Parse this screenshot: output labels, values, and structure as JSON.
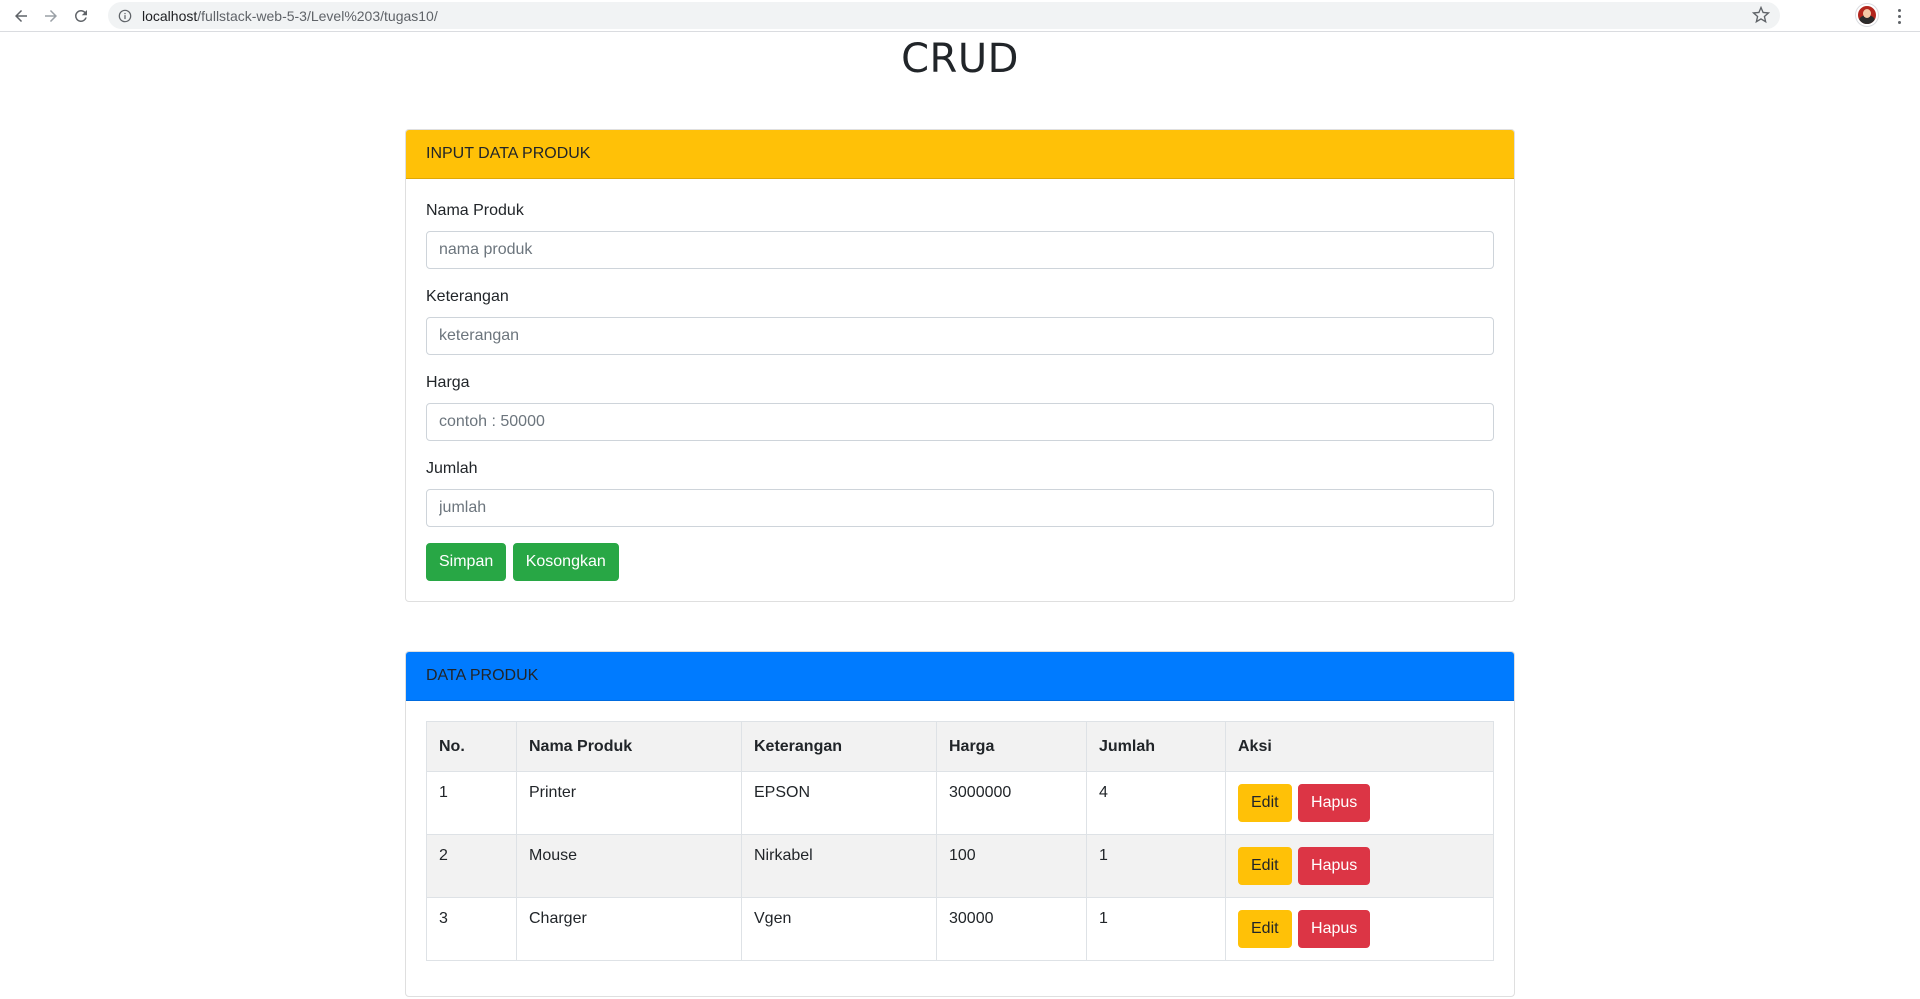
{
  "browser": {
    "url_host": "localhost",
    "url_path": "/fullstack-web-5-3/Level%203/tugas10/"
  },
  "page": {
    "title": "CRUD"
  },
  "input_card": {
    "header": "INPUT DATA PRODUK",
    "fields": [
      {
        "label": "Nama Produk",
        "placeholder": "nama produk",
        "value": ""
      },
      {
        "label": "Keterangan",
        "placeholder": "keterangan",
        "value": ""
      },
      {
        "label": "Harga",
        "placeholder": "contoh : 50000",
        "value": ""
      },
      {
        "label": "Jumlah",
        "placeholder": "jumlah",
        "value": ""
      }
    ],
    "save_label": "Simpan",
    "clear_label": "Kosongkan"
  },
  "table_card": {
    "header": "DATA PRODUK",
    "columns": [
      "No.",
      "Nama Produk",
      "Keterangan",
      "Harga",
      "Jumlah",
      "Aksi"
    ],
    "rows": [
      {
        "no": "1",
        "nama": "Printer",
        "keterangan": "EPSON",
        "harga": "3000000",
        "jumlah": "4"
      },
      {
        "no": "2",
        "nama": "Mouse",
        "keterangan": "Nirkabel",
        "harga": "100",
        "jumlah": "1"
      },
      {
        "no": "3",
        "nama": "Charger",
        "keterangan": "Vgen",
        "harga": "30000",
        "jumlah": "1"
      }
    ],
    "edit_label": "Edit",
    "delete_label": "Hapus"
  },
  "colors": {
    "warning": "#ffc107",
    "primary": "#007bff",
    "success": "#28a745",
    "danger": "#dc3545"
  }
}
